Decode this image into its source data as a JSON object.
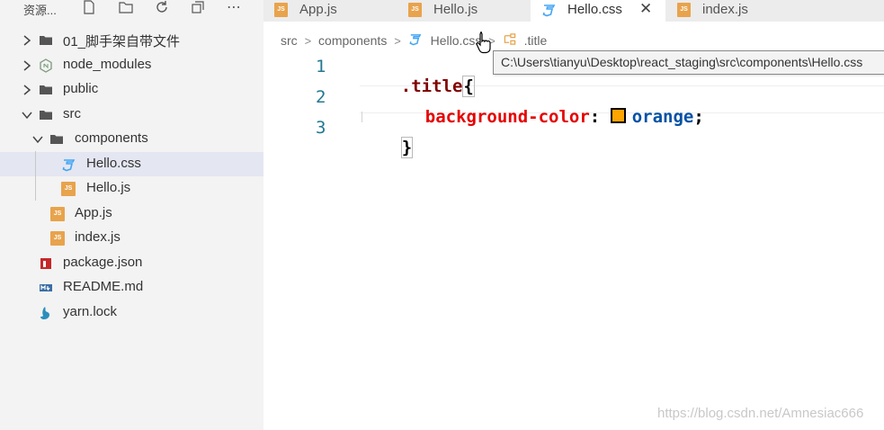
{
  "sidebar": {
    "title": "资源...",
    "tree": [
      {
        "label": "01_脚手架自带文件",
        "type": "folder",
        "expanded": false,
        "icon": "folder-icon"
      },
      {
        "label": "node_modules",
        "type": "folder",
        "expanded": false,
        "icon": "node-modules-icon"
      },
      {
        "label": "public",
        "type": "folder",
        "expanded": false,
        "icon": "folder-icon"
      },
      {
        "label": "src",
        "type": "folder",
        "expanded": true,
        "icon": "folder-icon"
      },
      {
        "label": "components",
        "type": "folder",
        "expanded": true,
        "icon": "folder-icon"
      },
      {
        "label": "Hello.css",
        "type": "file",
        "icon": "css-file-icon",
        "selected": true
      },
      {
        "label": "Hello.js",
        "type": "file",
        "icon": "js-file-icon"
      },
      {
        "label": "App.js",
        "type": "file",
        "icon": "js-file-icon"
      },
      {
        "label": "index.js",
        "type": "file",
        "icon": "js-file-icon"
      },
      {
        "label": "package.json",
        "type": "file",
        "icon": "npm-package-icon"
      },
      {
        "label": "README.md",
        "type": "file",
        "icon": "markdown-file-icon"
      },
      {
        "label": "yarn.lock",
        "type": "file",
        "icon": "yarn-icon"
      }
    ],
    "js_badge": "JS"
  },
  "tabs": [
    {
      "label": "App.js",
      "icon": "js-file-icon",
      "active": false
    },
    {
      "label": "Hello.js",
      "icon": "js-file-icon",
      "active": false
    },
    {
      "label": "Hello.css",
      "icon": "css-file-icon",
      "active": true,
      "close": "✕"
    },
    {
      "label": "index.js",
      "icon": "js-file-icon",
      "active": false
    }
  ],
  "breadcrumb": {
    "items": [
      "src",
      "components",
      "Hello.css",
      ".title"
    ]
  },
  "tooltip": {
    "text": "C:\\Users\\tianyu\\Desktop\\react_staging\\src\\components\\Hello.css"
  },
  "editor": {
    "line_numbers": [
      "1",
      "2",
      "3"
    ],
    "line1_selector": ".title",
    "line1_brace": "{",
    "line2_property": "background-color",
    "line2_colon": ":",
    "line2_value": "orange",
    "line2_semicolon": ";",
    "line3_brace": "}",
    "swatch_color": "#ffa500"
  },
  "watermark": "https://blog.csdn.net/Amnesiac666"
}
